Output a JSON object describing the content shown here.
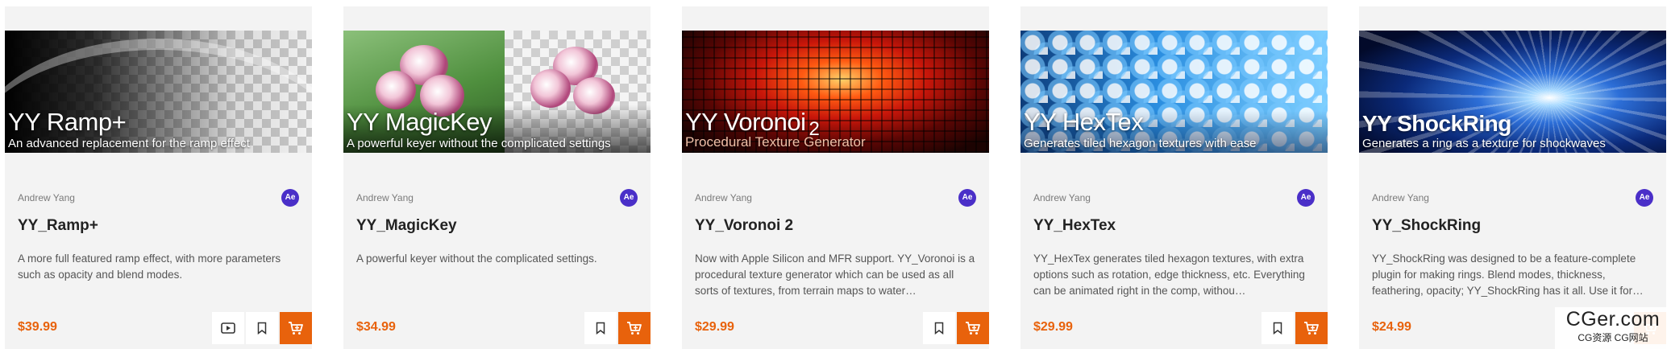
{
  "products": [
    {
      "banner_title": "YY Ramp+",
      "banner_suffix": "",
      "banner_subtitle": "An advanced replacement for the ramp effect",
      "author": "Andrew Yang",
      "app_badge": "Ae",
      "title": "YY_Ramp+",
      "description": "A more full featured ramp effect, with more parameters such as opacity and blend modes.",
      "price": "$39.99",
      "has_video": true
    },
    {
      "banner_title": "YY MagicKey",
      "banner_suffix": "",
      "banner_subtitle": "A powerful keyer without the complicated settings",
      "author": "Andrew Yang",
      "app_badge": "Ae",
      "title": "YY_MagicKey",
      "description": "A powerful keyer without the complicated settings.",
      "price": "$34.99",
      "has_video": false
    },
    {
      "banner_title": "YY Voronoi",
      "banner_suffix": "2",
      "banner_subtitle": "Procedural Texture Generator",
      "author": "Andrew Yang",
      "app_badge": "Ae",
      "title": "YY_Voronoi 2",
      "description": "Now with Apple Silicon and MFR support. YY_Voronoi is a procedural texture generator which can be used as all sorts of textures, from terrain maps to water…",
      "price": "$29.99",
      "has_video": false
    },
    {
      "banner_title": "YY HexTex",
      "banner_suffix": "",
      "banner_subtitle": "Generates tiled hexagon textures with ease",
      "author": "Andrew Yang",
      "app_badge": "Ae",
      "title": "YY_HexTex",
      "description": "YY_HexTex generates tiled hexagon textures, with extra options such as rotation, edge thickness, etc. Everything can be animated right in the comp, withou…",
      "price": "$29.99",
      "has_video": false
    },
    {
      "banner_title": "YY ShockRing",
      "banner_suffix": "",
      "banner_subtitle": "Generates a ring as a texture for shockwaves",
      "author": "Andrew Yang",
      "app_badge": "Ae",
      "title": "YY_ShockRing",
      "description": "YY_ShockRing was designed to be a feature-complete plugin for making rings. Blend modes, thickness, feathering, opacity; YY_ShockRing has it all. Use it for…",
      "price": "$24.99",
      "has_video": false
    }
  ],
  "icons": {
    "video": "video-play-icon",
    "wishlist": "bookmark-icon",
    "cart": "cart-icon"
  },
  "colors": {
    "accent": "#e8620c",
    "badge": "#4a2fc8",
    "card_bg": "#f3f3f3"
  },
  "watermark": {
    "main": "CGer.com",
    "sub": "CG资源 CG网站"
  }
}
